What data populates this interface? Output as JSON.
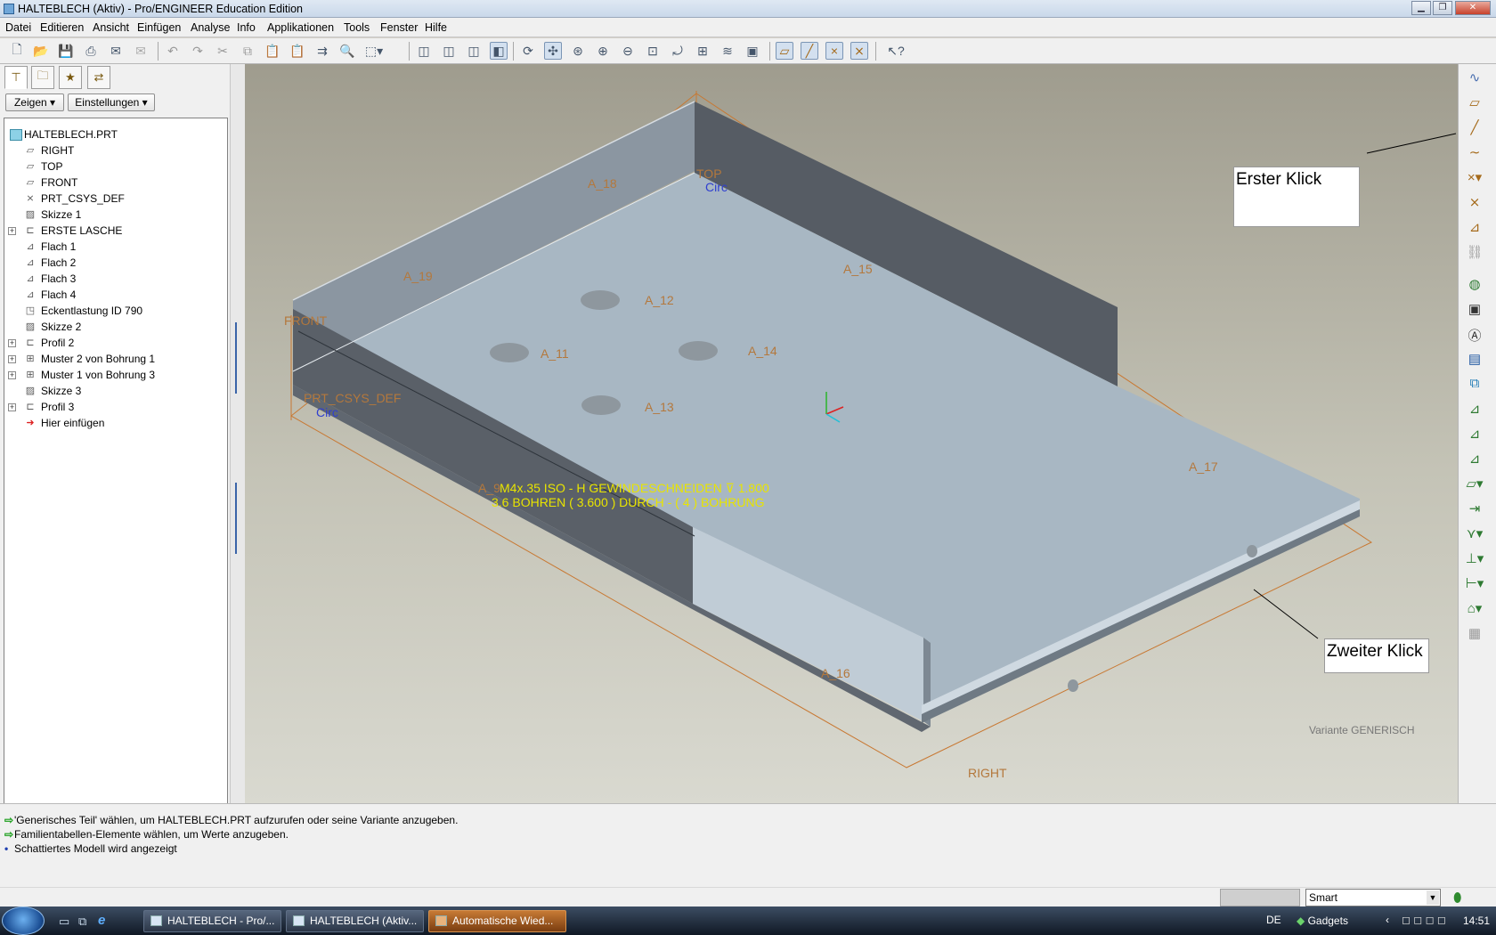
{
  "window": {
    "title": "HALTEBLECH (Aktiv) - Pro/ENGINEER Education Edition"
  },
  "menu": [
    "Datei",
    "Editieren",
    "Ansicht",
    "Einfügen",
    "Analyse",
    "Info",
    "Applikationen",
    "Tools",
    "Fenster",
    "Hilfe"
  ],
  "panel": {
    "show_label": "Zeigen",
    "settings_label": "Einstellungen"
  },
  "tree": {
    "root": "HALTEBLECH.PRT",
    "items": [
      {
        "label": "RIGHT",
        "icon": "datum-plane-icon",
        "expandable": false
      },
      {
        "label": "TOP",
        "icon": "datum-plane-icon",
        "expandable": false
      },
      {
        "label": "FRONT",
        "icon": "datum-plane-icon",
        "expandable": false
      },
      {
        "label": "PRT_CSYS_DEF",
        "icon": "csys-icon",
        "expandable": false
      },
      {
        "label": "Skizze 1",
        "icon": "sketch-icon",
        "expandable": false
      },
      {
        "label": "ERSTE LASCHE",
        "icon": "wall-icon",
        "expandable": true
      },
      {
        "label": "Flach 1",
        "icon": "flat-icon",
        "expandable": false
      },
      {
        "label": "Flach 2",
        "icon": "flat-icon",
        "expandable": false
      },
      {
        "label": "Flach 3",
        "icon": "flat-icon",
        "expandable": false
      },
      {
        "label": "Flach 4",
        "icon": "flat-icon",
        "expandable": false
      },
      {
        "label": "Eckentlastung ID 790",
        "icon": "corner-relief-icon",
        "expandable": false
      },
      {
        "label": "Skizze 2",
        "icon": "sketch-icon",
        "expandable": false
      },
      {
        "label": "Profil 2",
        "icon": "wall-icon",
        "expandable": true
      },
      {
        "label": "Muster 2 von Bohrung 1",
        "icon": "pattern-icon",
        "expandable": true
      },
      {
        "label": "Muster 1 von Bohrung 3",
        "icon": "pattern-icon",
        "expandable": true
      },
      {
        "label": "Skizze 3",
        "icon": "sketch-icon",
        "expandable": false
      },
      {
        "label": "Profil 3",
        "icon": "wall-icon",
        "expandable": true
      },
      {
        "label": "Hier einfügen",
        "icon": "insert-arrow-icon",
        "expandable": false
      }
    ]
  },
  "viewport": {
    "datums": {
      "top": "TOP",
      "front": "FRONT",
      "right": "RIGHT",
      "csys": "PRT_CSYS_DEF",
      "circ1": "Circ",
      "circ2": "Circ"
    },
    "axes": [
      "A_18",
      "A_19",
      "A_15",
      "A_12",
      "A_11",
      "A_14",
      "A_13",
      "A_17",
      "A_16",
      "A_9"
    ],
    "annotation": [
      "M4x.35 ISO - H GEWINDESCHNEIDEN ⊽ 1.800",
      "3.6 BOHREN ( 3.600 ) DURCH - ( 4 ) BOHRUNG"
    ],
    "variant": "Variante GENERISCH",
    "callouts": {
      "first": "Erster Klick",
      "second": "Zweiter Klick"
    }
  },
  "messages": [
    {
      "text": "'Generisches Teil' wählen, um HALTEBLECH.PRT aufzurufen oder seine Variante anzugeben.",
      "type": "prompt"
    },
    {
      "text": "Familientabellen-Elemente wählen, um Werte anzugeben.",
      "type": "prompt"
    },
    {
      "text": "Schattiertes Modell wird angezeigt",
      "type": "info"
    }
  ],
  "status": {
    "filter": "Smart"
  },
  "taskbar": {
    "tasks": [
      "HALTEBLECH - Pro/...",
      "HALTEBLECH (Aktiv...",
      "Automatische Wied..."
    ],
    "lang": "DE",
    "gadgets": "Gadgets",
    "clock": "14:51"
  },
  "colors": {
    "accent": "#c87832",
    "annotation": "#e8e400",
    "sheet_top": "#a8b7c3",
    "wall": "#565c64"
  }
}
